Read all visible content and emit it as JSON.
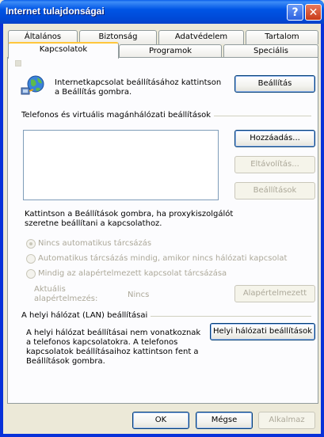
{
  "window": {
    "title": "Internet tulajdonságai"
  },
  "titlebar": {
    "help_glyph": "?",
    "close_glyph": "✕"
  },
  "tabs_row1": [
    "Általános",
    "Biztonság",
    "Adatvédelem",
    "Tartalom"
  ],
  "tabs_row2": [
    "Kapcsolatok",
    "Programok",
    "Speciális"
  ],
  "active_tab": "Kapcsolatok",
  "setup": {
    "text_line1": "Internetkapcsolat beállításához kattintson",
    "text_line2": "a Beállítás gombra.",
    "button": "Beállítás",
    "icon": "globe-network-icon"
  },
  "vpn": {
    "heading": "Telefonos és virtuális magánhálózati beállítások",
    "add_button": "Hozzáadás...",
    "remove_button": "Eltávolítás...",
    "settings_button": "Beállítások",
    "proxy_line1": "Kattintson a Beállítások gombra, ha proxykiszolgálót",
    "proxy_line2": "szeretne beállítani a kapcsolathoz.",
    "radio_options": [
      "Nincs automatikus tárcsázás",
      "Automatikus tárcsázás mindig, amikor nincs hálózati kapcsolat",
      "Mindig az alapértelmezett kapcsolat tárcsázása"
    ],
    "selected_option": 0,
    "current_default_label_line1": "Aktuális",
    "current_default_label_line2": "alapértelmezés:",
    "current_default_value": "Nincs",
    "set_default_button": "Alapértelmezett"
  },
  "lan": {
    "heading": "A helyi hálózat (LAN) beállításai",
    "text_line1": "A helyi hálózat beállításai nem vonatkoznak",
    "text_line2": "a telefonos kapcsolatokra. A telefonos",
    "text_line3": "kapcsolatok beállításaihoz kattintson fent a",
    "text_line4": "Beállítások gombra.",
    "button": "Helyi hálózati beállítások"
  },
  "footer": {
    "ok": "OK",
    "cancel": "Mégse",
    "apply": "Alkalmaz"
  }
}
